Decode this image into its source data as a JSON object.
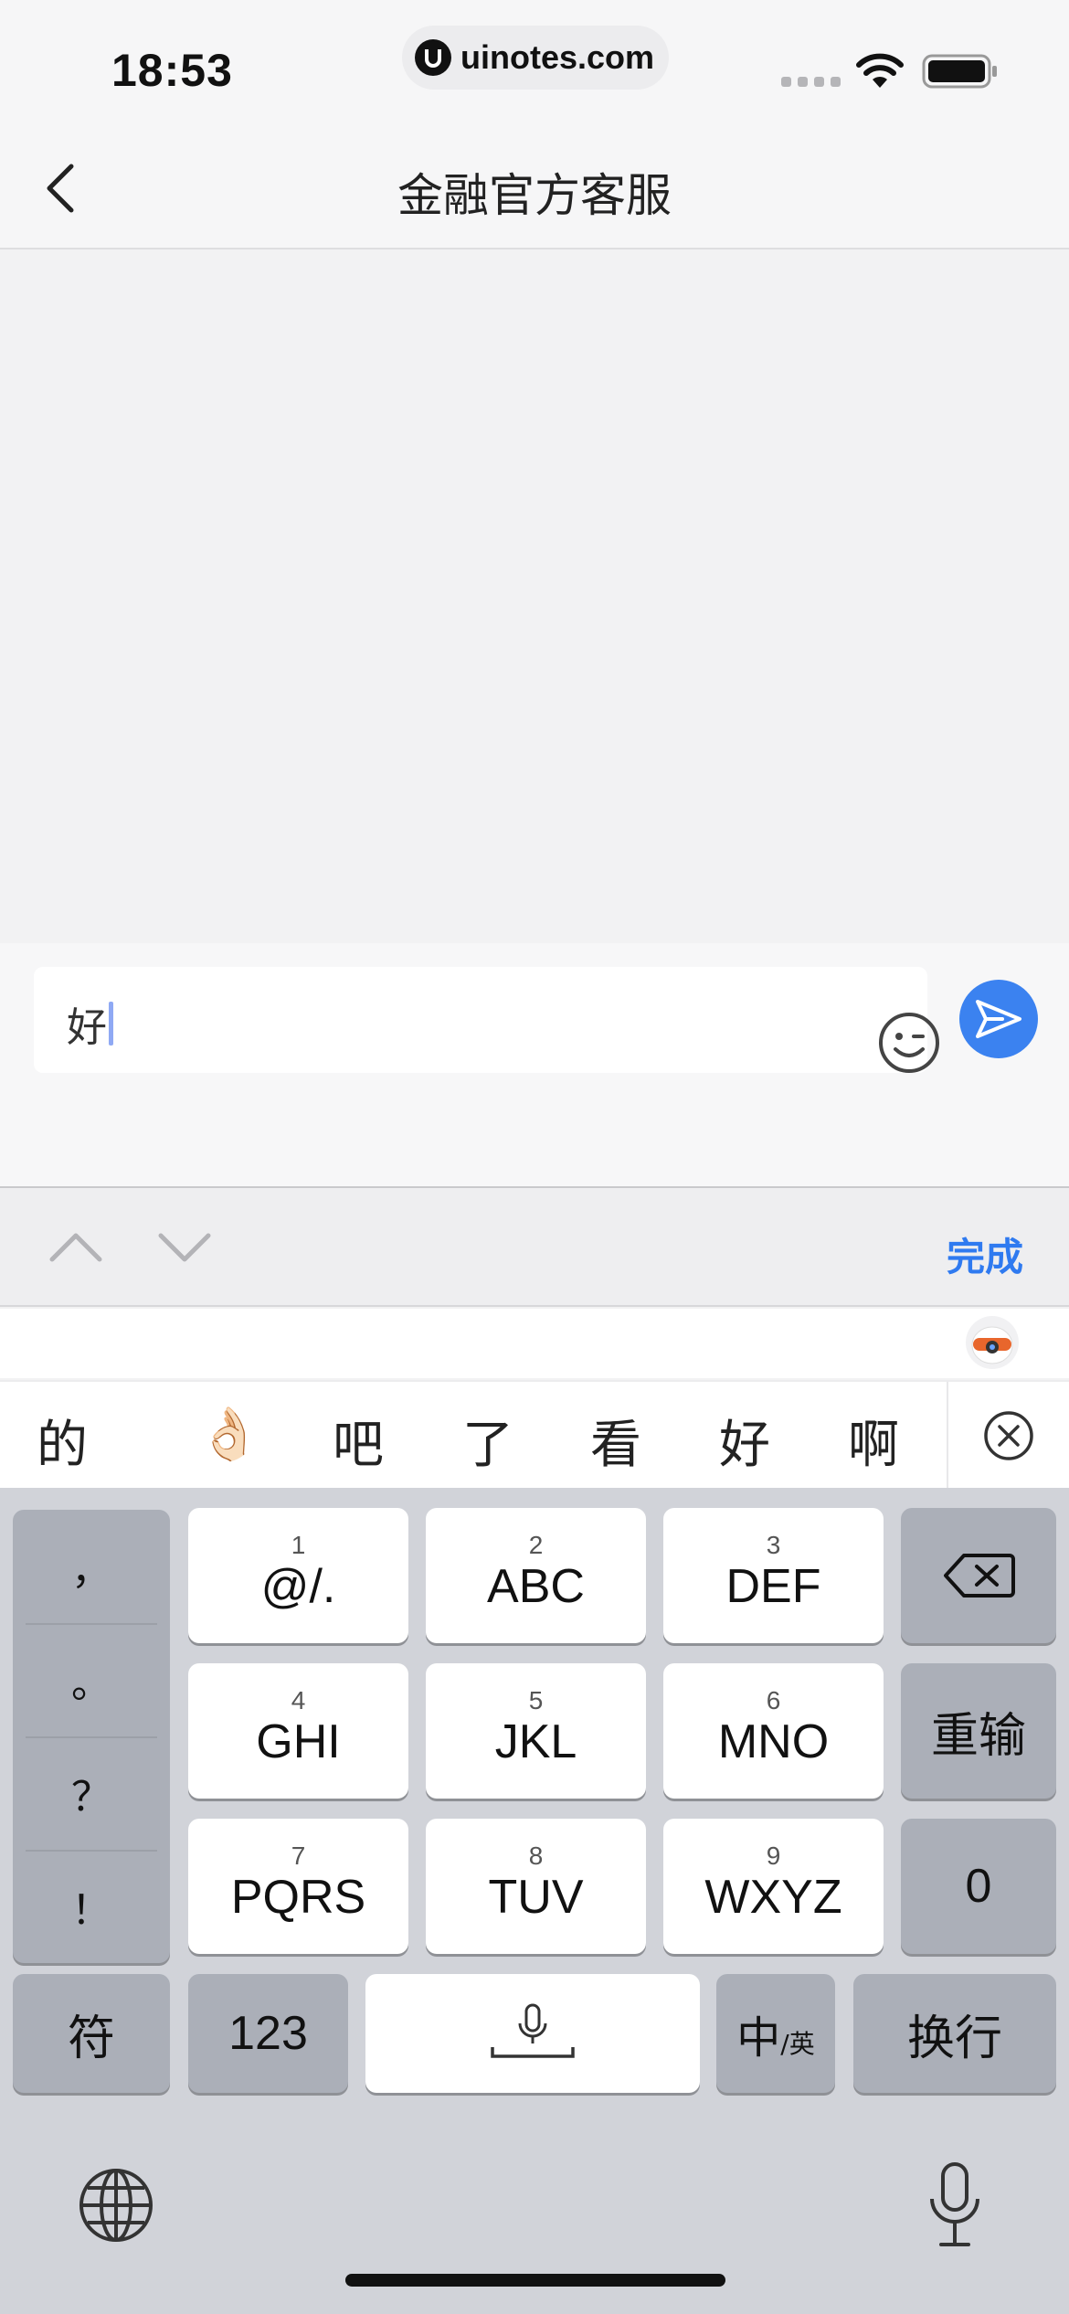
{
  "status": {
    "time": "18:53",
    "url": "uinotes.com",
    "url_logo_letter": "U"
  },
  "nav": {
    "back_icon": "chevron-left-icon",
    "title": "金融官方客服"
  },
  "input": {
    "value": "好",
    "emoji_icon": "smile-wink-icon",
    "send_icon": "send-arrow-icon",
    "send_color": "#3b82f0"
  },
  "toolbar": {
    "done_label": "完成",
    "done_color": "#2f7af0"
  },
  "candidates": [
    "的",
    "👌🏻",
    "吧",
    "了",
    "看",
    "好",
    "啊"
  ],
  "keyboard": {
    "punctuation": [
      "，",
      "。",
      "？",
      "！"
    ],
    "keys": [
      {
        "num": "1",
        "letters": "@/."
      },
      {
        "num": "2",
        "letters": "ABC"
      },
      {
        "num": "3",
        "letters": "DEF"
      },
      {
        "num": "4",
        "letters": "GHI"
      },
      {
        "num": "5",
        "letters": "JKL"
      },
      {
        "num": "6",
        "letters": "MNO"
      },
      {
        "num": "7",
        "letters": "PQRS"
      },
      {
        "num": "8",
        "letters": "TUV"
      },
      {
        "num": "9",
        "letters": "WXYZ"
      }
    ],
    "delete_icon": "backspace-icon",
    "reset_label": "重输",
    "zero_label": "0",
    "symbol_label": "符",
    "numeric_label": "123",
    "lang_main": "中",
    "lang_sub": "/英",
    "return_label": "换行",
    "globe_icon": "globe-icon",
    "mic_icon": "microphone-icon"
  }
}
